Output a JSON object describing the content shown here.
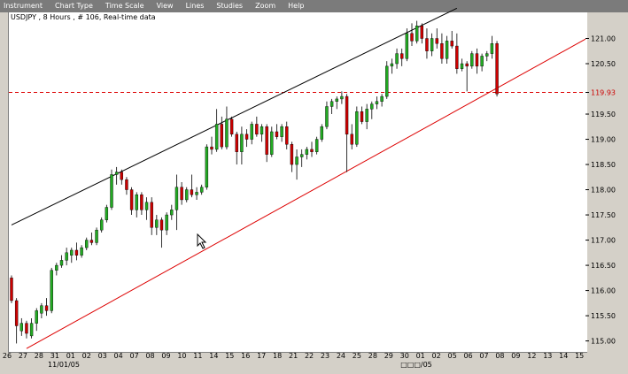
{
  "menu": [
    "Instrument",
    "Chart Type",
    "Time Scale",
    "View",
    "Lines",
    "Studies",
    "Zoom",
    "Help"
  ],
  "chart_info": "USDJPY , 8 Hours , # 106, Real-time data",
  "colors": {
    "up": "#22aa22",
    "down": "#cc0000",
    "channel_upper": "#000000",
    "channel_lower": "#dd0000",
    "ref_line": "#dd0000",
    "background": "#ffffff"
  },
  "chart_data": {
    "type": "candlestick",
    "symbol": "USDJPY",
    "interval": "8 Hours",
    "ylim": [
      114.8,
      121.5
    ],
    "yticks": [
      "121.00",
      "120.50",
      "119.93",
      "119.50",
      "119.00",
      "118.50",
      "118.00",
      "117.50",
      "117.00",
      "116.50",
      "116.00",
      "115.50",
      "115.00"
    ],
    "current_level": 119.93,
    "x_ticks": [
      "26",
      "27",
      "28",
      "31",
      "01",
      "02",
      "03",
      "04",
      "07",
      "08",
      "09",
      "10",
      "11",
      "14",
      "15",
      "16",
      "17",
      "18",
      "21",
      "22",
      "23",
      "24",
      "25",
      "28",
      "29",
      "30",
      "01",
      "02",
      "05",
      "06",
      "07",
      "08",
      "09",
      "12",
      "13",
      "14",
      "15"
    ],
    "month_labels": [
      "11/01/05",
      "□□□/05"
    ],
    "candles": [
      {
        "o": 116.25,
        "h": 116.3,
        "l": 115.75,
        "c": 115.8
      },
      {
        "o": 115.8,
        "h": 115.85,
        "l": 114.95,
        "c": 115.3
      },
      {
        "o": 115.2,
        "h": 115.45,
        "l": 115.1,
        "c": 115.35
      },
      {
        "o": 115.35,
        "h": 115.4,
        "l": 115.05,
        "c": 115.15
      },
      {
        "o": 115.1,
        "h": 115.45,
        "l": 115.05,
        "c": 115.35
      },
      {
        "o": 115.35,
        "h": 115.65,
        "l": 115.2,
        "c": 115.6
      },
      {
        "o": 115.55,
        "h": 115.75,
        "l": 115.45,
        "c": 115.7
      },
      {
        "o": 115.7,
        "h": 115.85,
        "l": 115.5,
        "c": 115.6
      },
      {
        "o": 115.6,
        "h": 116.45,
        "l": 115.55,
        "c": 116.4
      },
      {
        "o": 116.4,
        "h": 116.55,
        "l": 116.3,
        "c": 116.5
      },
      {
        "o": 116.5,
        "h": 116.7,
        "l": 116.45,
        "c": 116.6
      },
      {
        "o": 116.6,
        "h": 116.85,
        "l": 116.5,
        "c": 116.75
      },
      {
        "o": 116.7,
        "h": 116.85,
        "l": 116.55,
        "c": 116.8
      },
      {
        "o": 116.8,
        "h": 116.95,
        "l": 116.6,
        "c": 116.7
      },
      {
        "o": 116.7,
        "h": 116.9,
        "l": 116.65,
        "c": 116.85
      },
      {
        "o": 116.85,
        "h": 117.05,
        "l": 116.8,
        "c": 117.0
      },
      {
        "o": 117.0,
        "h": 117.15,
        "l": 116.9,
        "c": 116.95
      },
      {
        "o": 116.95,
        "h": 117.25,
        "l": 116.9,
        "c": 117.2
      },
      {
        "o": 117.2,
        "h": 117.45,
        "l": 117.15,
        "c": 117.4
      },
      {
        "o": 117.4,
        "h": 117.7,
        "l": 117.35,
        "c": 117.65
      },
      {
        "o": 117.65,
        "h": 118.4,
        "l": 117.6,
        "c": 118.3
      },
      {
        "o": 118.3,
        "h": 118.45,
        "l": 118.1,
        "c": 118.35
      },
      {
        "o": 118.35,
        "h": 118.4,
        "l": 118.1,
        "c": 118.2
      },
      {
        "o": 118.2,
        "h": 118.25,
        "l": 117.9,
        "c": 118.0
      },
      {
        "o": 118.0,
        "h": 118.05,
        "l": 117.5,
        "c": 117.6
      },
      {
        "o": 117.6,
        "h": 117.95,
        "l": 117.45,
        "c": 117.9
      },
      {
        "o": 117.9,
        "h": 117.95,
        "l": 117.5,
        "c": 117.6
      },
      {
        "o": 117.6,
        "h": 117.85,
        "l": 117.4,
        "c": 117.75
      },
      {
        "o": 117.75,
        "h": 117.85,
        "l": 117.1,
        "c": 117.25
      },
      {
        "o": 117.25,
        "h": 117.5,
        "l": 117.1,
        "c": 117.4
      },
      {
        "o": 117.4,
        "h": 117.45,
        "l": 116.85,
        "c": 117.2
      },
      {
        "o": 117.2,
        "h": 117.55,
        "l": 117.1,
        "c": 117.5
      },
      {
        "o": 117.5,
        "h": 117.7,
        "l": 117.4,
        "c": 117.6
      },
      {
        "o": 117.6,
        "h": 118.3,
        "l": 117.2,
        "c": 118.05
      },
      {
        "o": 118.05,
        "h": 118.15,
        "l": 117.7,
        "c": 117.8
      },
      {
        "o": 117.8,
        "h": 118.05,
        "l": 117.75,
        "c": 118.0
      },
      {
        "o": 118.0,
        "h": 118.3,
        "l": 117.85,
        "c": 117.9
      },
      {
        "o": 117.9,
        "h": 118.05,
        "l": 117.8,
        "c": 117.95
      },
      {
        "o": 117.95,
        "h": 118.1,
        "l": 117.9,
        "c": 118.05
      },
      {
        "o": 118.05,
        "h": 118.9,
        "l": 118.0,
        "c": 118.85
      },
      {
        "o": 118.85,
        "h": 119.05,
        "l": 118.7,
        "c": 118.8
      },
      {
        "o": 118.8,
        "h": 119.6,
        "l": 118.75,
        "c": 119.3
      },
      {
        "o": 119.3,
        "h": 119.45,
        "l": 118.8,
        "c": 118.85
      },
      {
        "o": 118.85,
        "h": 119.65,
        "l": 118.8,
        "c": 119.4
      },
      {
        "o": 119.4,
        "h": 119.45,
        "l": 119.05,
        "c": 119.1
      },
      {
        "o": 119.1,
        "h": 119.15,
        "l": 118.5,
        "c": 118.75
      },
      {
        "o": 118.75,
        "h": 119.25,
        "l": 118.5,
        "c": 119.1
      },
      {
        "o": 119.1,
        "h": 119.2,
        "l": 118.85,
        "c": 119.0
      },
      {
        "o": 119.0,
        "h": 119.35,
        "l": 118.9,
        "c": 119.3
      },
      {
        "o": 119.3,
        "h": 119.45,
        "l": 119.05,
        "c": 119.1
      },
      {
        "o": 119.1,
        "h": 119.3,
        "l": 118.95,
        "c": 119.25
      },
      {
        "o": 119.25,
        "h": 119.3,
        "l": 118.55,
        "c": 118.7
      },
      {
        "o": 118.7,
        "h": 119.25,
        "l": 118.65,
        "c": 119.15
      },
      {
        "o": 119.15,
        "h": 119.3,
        "l": 119.0,
        "c": 119.05
      },
      {
        "o": 119.05,
        "h": 119.3,
        "l": 118.95,
        "c": 119.25
      },
      {
        "o": 119.25,
        "h": 119.35,
        "l": 118.8,
        "c": 118.9
      },
      {
        "o": 118.9,
        "h": 118.95,
        "l": 118.35,
        "c": 118.5
      },
      {
        "o": 118.5,
        "h": 118.8,
        "l": 118.2,
        "c": 118.65
      },
      {
        "o": 118.65,
        "h": 118.8,
        "l": 118.45,
        "c": 118.7
      },
      {
        "o": 118.7,
        "h": 118.85,
        "l": 118.6,
        "c": 118.8
      },
      {
        "o": 118.8,
        "h": 118.95,
        "l": 118.65,
        "c": 118.75
      },
      {
        "o": 118.75,
        "h": 119.05,
        "l": 118.7,
        "c": 119.0
      },
      {
        "o": 119.0,
        "h": 119.3,
        "l": 118.95,
        "c": 119.25
      },
      {
        "o": 119.25,
        "h": 119.75,
        "l": 119.2,
        "c": 119.65
      },
      {
        "o": 119.65,
        "h": 119.8,
        "l": 119.5,
        "c": 119.75
      },
      {
        "o": 119.75,
        "h": 119.85,
        "l": 119.6,
        "c": 119.8
      },
      {
        "o": 119.8,
        "h": 119.95,
        "l": 119.7,
        "c": 119.85
      },
      {
        "o": 119.85,
        "h": 119.9,
        "l": 118.35,
        "c": 119.1
      },
      {
        "o": 119.1,
        "h": 119.3,
        "l": 118.8,
        "c": 118.9
      },
      {
        "o": 118.9,
        "h": 119.65,
        "l": 118.85,
        "c": 119.55
      },
      {
        "o": 119.55,
        "h": 119.65,
        "l": 119.3,
        "c": 119.35
      },
      {
        "o": 119.35,
        "h": 119.7,
        "l": 119.2,
        "c": 119.6
      },
      {
        "o": 119.6,
        "h": 119.75,
        "l": 119.4,
        "c": 119.7
      },
      {
        "o": 119.7,
        "h": 119.85,
        "l": 119.6,
        "c": 119.75
      },
      {
        "o": 119.75,
        "h": 119.9,
        "l": 119.65,
        "c": 119.85
      },
      {
        "o": 119.85,
        "h": 120.55,
        "l": 119.8,
        "c": 120.45
      },
      {
        "o": 120.45,
        "h": 120.6,
        "l": 120.3,
        "c": 120.5
      },
      {
        "o": 120.5,
        "h": 120.8,
        "l": 120.4,
        "c": 120.7
      },
      {
        "o": 120.7,
        "h": 120.8,
        "l": 120.45,
        "c": 120.6
      },
      {
        "o": 120.6,
        "h": 121.2,
        "l": 120.55,
        "c": 121.1
      },
      {
        "o": 121.1,
        "h": 121.3,
        "l": 120.85,
        "c": 120.95
      },
      {
        "o": 120.95,
        "h": 121.35,
        "l": 120.9,
        "c": 121.25
      },
      {
        "o": 121.25,
        "h": 121.3,
        "l": 120.9,
        "c": 121.0
      },
      {
        "o": 121.0,
        "h": 121.2,
        "l": 120.6,
        "c": 120.75
      },
      {
        "o": 120.75,
        "h": 121.1,
        "l": 120.65,
        "c": 121.0
      },
      {
        "o": 121.0,
        "h": 121.2,
        "l": 120.8,
        "c": 120.9
      },
      {
        "o": 120.9,
        "h": 121.1,
        "l": 120.5,
        "c": 120.6
      },
      {
        "o": 120.6,
        "h": 121.05,
        "l": 120.5,
        "c": 120.95
      },
      {
        "o": 120.95,
        "h": 121.15,
        "l": 120.8,
        "c": 120.85
      },
      {
        "o": 120.85,
        "h": 121.1,
        "l": 120.3,
        "c": 120.4
      },
      {
        "o": 120.4,
        "h": 120.6,
        "l": 120.35,
        "c": 120.5
      },
      {
        "o": 120.5,
        "h": 120.55,
        "l": 119.95,
        "c": 120.45
      },
      {
        "o": 120.45,
        "h": 120.75,
        "l": 120.4,
        "c": 120.7
      },
      {
        "o": 120.7,
        "h": 120.8,
        "l": 120.3,
        "c": 120.45
      },
      {
        "o": 120.45,
        "h": 120.7,
        "l": 120.35,
        "c": 120.65
      },
      {
        "o": 120.65,
        "h": 120.75,
        "l": 120.55,
        "c": 120.7
      },
      {
        "o": 120.7,
        "h": 121.05,
        "l": 120.6,
        "c": 120.9
      },
      {
        "o": 120.9,
        "h": 120.95,
        "l": 119.85,
        "c": 119.9
      }
    ],
    "trendlines": [
      {
        "name": "",
        "points": [
          [
            0,
            117.3
          ],
          [
            89,
            121.6
          ]
        ]
      },
      {
        "name": "",
        "points": [
          [
            3,
            114.85
          ],
          [
            104,
            120.4
          ]
        ]
      }
    ]
  }
}
